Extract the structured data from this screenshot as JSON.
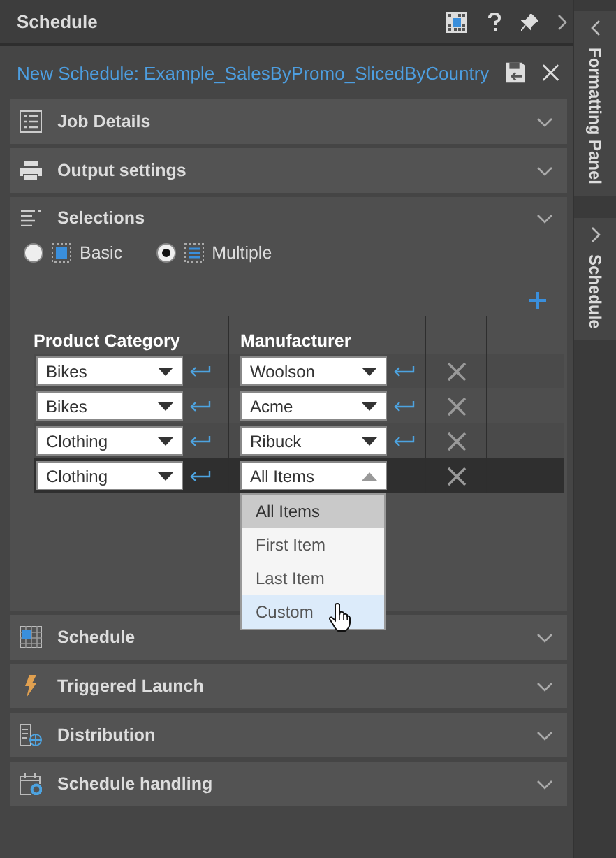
{
  "panel": {
    "title": "Schedule"
  },
  "schedule_name": "New Schedule: Example_SalesByPromo_SlicedByCountry",
  "side_tabs": [
    {
      "label": "Formatting Panel"
    },
    {
      "label": "Schedule"
    }
  ],
  "sections": [
    {
      "title": "Job Details",
      "expanded": false
    },
    {
      "title": "Output settings",
      "expanded": false
    },
    {
      "title": "Selections",
      "expanded": true
    },
    {
      "title": "Schedule",
      "expanded": false
    },
    {
      "title": "Triggered Launch",
      "expanded": false
    },
    {
      "title": "Distribution",
      "expanded": false
    },
    {
      "title": "Schedule handling",
      "expanded": false
    }
  ],
  "selections": {
    "modes": [
      {
        "label": "Basic",
        "selected": false
      },
      {
        "label": "Multiple",
        "selected": true
      }
    ],
    "columns": [
      "Product Category",
      "Manufacturer"
    ],
    "rows": [
      {
        "category": "Bikes",
        "manufacturer": "Woolson",
        "selected": false
      },
      {
        "category": "Bikes",
        "manufacturer": "Acme",
        "selected": false
      },
      {
        "category": "Clothing",
        "manufacturer": "Ribuck",
        "selected": false
      },
      {
        "category": "Clothing",
        "manufacturer": "All Items",
        "selected": true,
        "menu": [
          {
            "label": "All Items",
            "selected": true,
            "hovered": false
          },
          {
            "label": "First Item",
            "selected": false,
            "hovered": false
          },
          {
            "label": "Last Item",
            "selected": false,
            "hovered": false
          },
          {
            "label": "Custom",
            "selected": false,
            "hovered": true
          }
        ]
      }
    ]
  }
}
